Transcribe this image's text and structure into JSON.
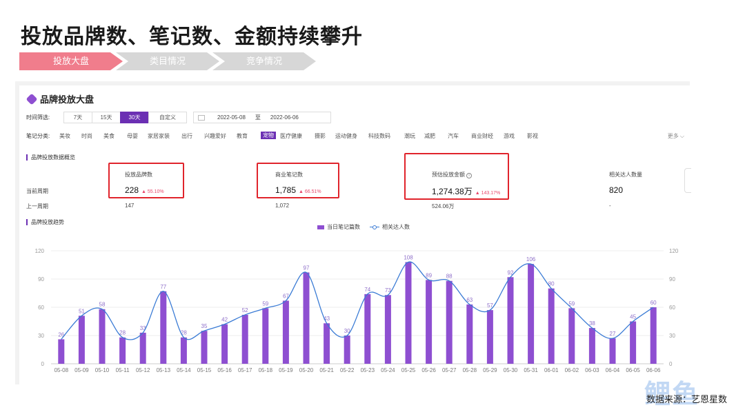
{
  "headline": "投放品牌数、笔记数、金额持续攀升",
  "steps": [
    "投放大盘",
    "类目情况",
    "竞争情况"
  ],
  "panel": {
    "title": "品牌投放大盘",
    "time_label": "时间筛选:",
    "time_buttons": [
      "7天",
      "15天",
      "30天",
      "自定义"
    ],
    "date_from": "2022-05-08",
    "date_sep": "至",
    "date_to": "2022-06-06",
    "category_label": "笔记分类:",
    "categories": [
      "美妆",
      "时尚",
      "美食",
      "母婴",
      "家居家装",
      "出行",
      "兴趣爱好",
      "教育",
      "宠物",
      "医疗健康",
      "摄影",
      "运动健身",
      "科技数码",
      "潮玩",
      "减肥",
      "汽车",
      "商业财经",
      "游戏",
      "影视"
    ],
    "category_active": "宠物",
    "more_label": "更多 ⌵",
    "overview_label": "品牌投放数据概览",
    "current_label": "当前周期",
    "previous_label": "上一周期",
    "stats": [
      {
        "title": "投放品牌数",
        "current": "228",
        "change": "▲ 55.10%",
        "previous": "147"
      },
      {
        "title": "商业笔记数",
        "current": "1,785",
        "change": "▲ 66.51%",
        "previous": "1,072"
      },
      {
        "title": "预估投放金额",
        "current": "1,274.38万",
        "change": "▲ 143.17%",
        "previous": "524.06万"
      },
      {
        "title": "相关达人数量",
        "current": "820",
        "change": "",
        "previous": "-"
      }
    ],
    "trend_label": "品牌投放趋势"
  },
  "legend": {
    "bar": "当日笔记篇数",
    "line": "相关达人数"
  },
  "colors": {
    "bar": "#8e4fd1",
    "line": "#3a7bd5",
    "accent": "#6b2fb3",
    "highlight": "#e0232b"
  },
  "chart_data": {
    "type": "bar",
    "categories": [
      "05-08",
      "05-09",
      "05-10",
      "05-11",
      "05-12",
      "05-13",
      "05-14",
      "05-15",
      "05-16",
      "05-17",
      "05-18",
      "05-19",
      "05-20",
      "05-21",
      "05-22",
      "05-23",
      "05-24",
      "05-25",
      "05-26",
      "05-27",
      "05-28",
      "05-29",
      "05-30",
      "05-31",
      "06-01",
      "06-02",
      "06-03",
      "06-04",
      "06-05",
      "06-06"
    ],
    "series": [
      {
        "name": "当日笔记篇数",
        "type": "bar",
        "values": [
          26,
          51,
          58,
          28,
          33,
          77,
          28,
          35,
          42,
          52,
          59,
          67,
          97,
          43,
          30,
          74,
          73,
          108,
          89,
          88,
          63,
          57,
          92,
          106,
          80,
          59,
          38,
          27,
          45,
          60
        ]
      },
      {
        "name": "相关达人数",
        "type": "line",
        "values": [
          26,
          51,
          58,
          28,
          33,
          77,
          28,
          35,
          42,
          52,
          59,
          67,
          97,
          43,
          30,
          74,
          73,
          108,
          89,
          88,
          63,
          57,
          92,
          106,
          80,
          59,
          38,
          27,
          45,
          60
        ]
      }
    ],
    "ylim": [
      0,
      120
    ],
    "yticks": [
      0,
      30,
      60,
      90,
      120
    ],
    "grid": true,
    "legend_position": "top"
  },
  "footer": {
    "source": "数据来源：艺恩星数",
    "watermark": "鲤鱼"
  }
}
